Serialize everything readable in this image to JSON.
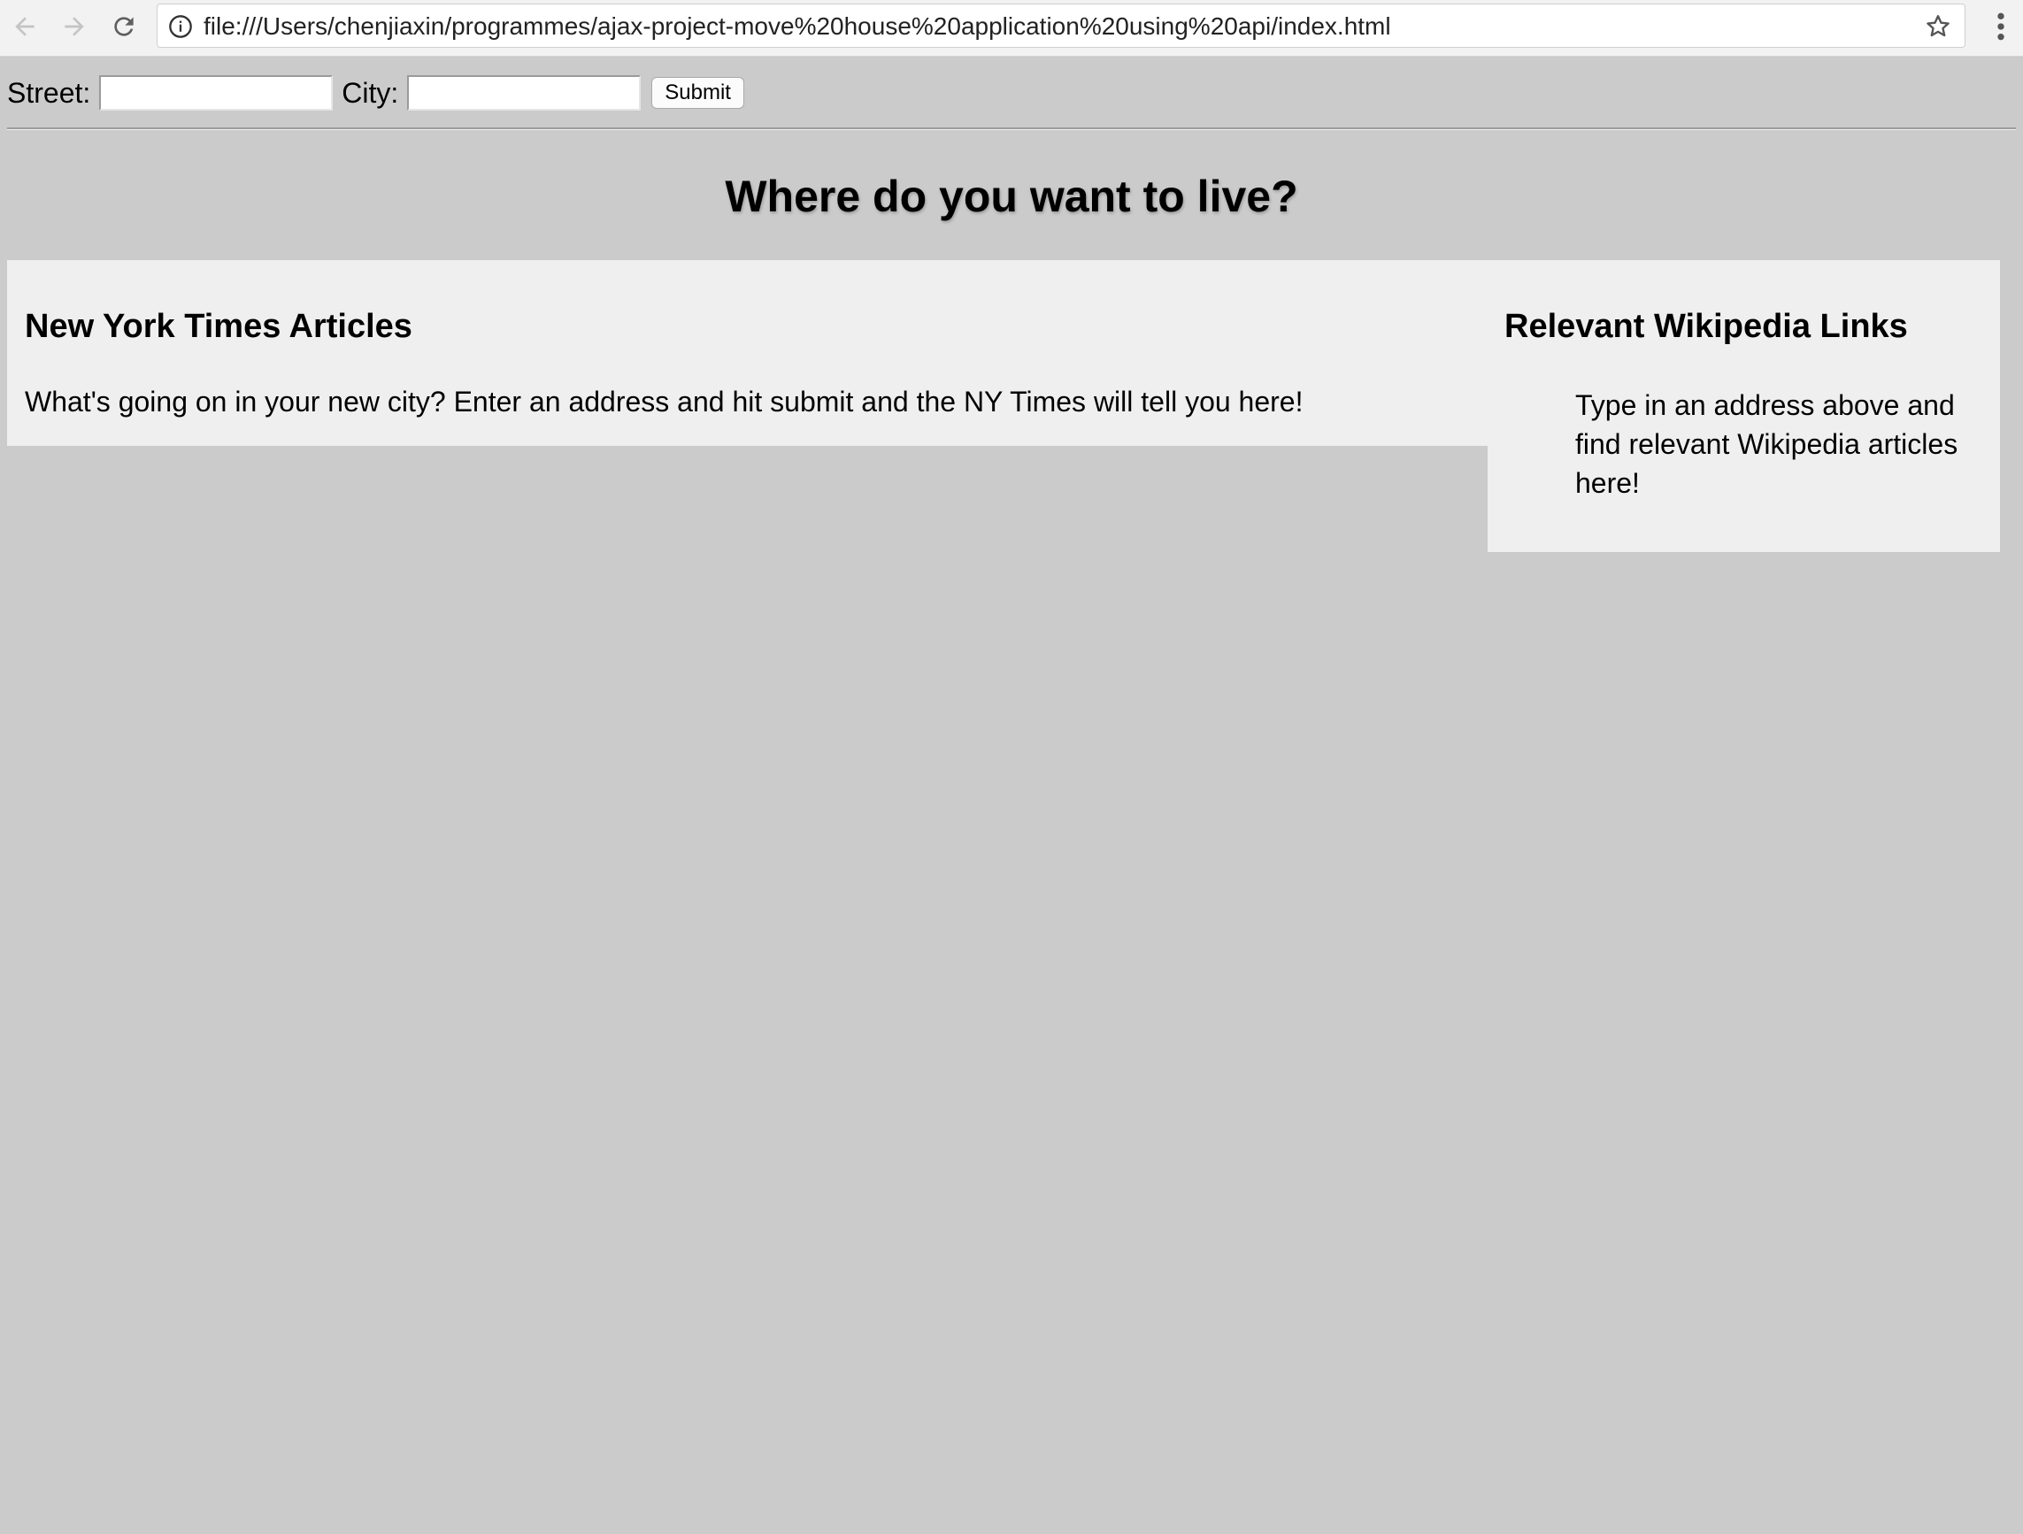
{
  "browser": {
    "url": "file:///Users/chenjiaxin/programmes/ajax-project-move%20house%20application%20using%20api/index.html",
    "icons": {
      "back": "arrow-left-icon",
      "forward": "arrow-right-icon",
      "reload": "reload-icon",
      "info": "info-icon",
      "bookmark": "star-icon",
      "menu": "kebab-menu-icon"
    }
  },
  "form": {
    "street_label": "Street:",
    "street_value": "",
    "city_label": "City:",
    "city_value": "",
    "submit_label": "Submit"
  },
  "page": {
    "greeting": "Where do you want to live?",
    "background_color": "#cbcbcb",
    "panel_color": "#efefef"
  },
  "nyt": {
    "header": "New York Times Articles",
    "text": "What's going on in your new city? Enter an address and hit submit and the NY Times will tell you here!"
  },
  "wiki": {
    "header": "Relevant Wikipedia Links",
    "text": "Type in an address above and find relevant Wikipedia articles here!"
  }
}
